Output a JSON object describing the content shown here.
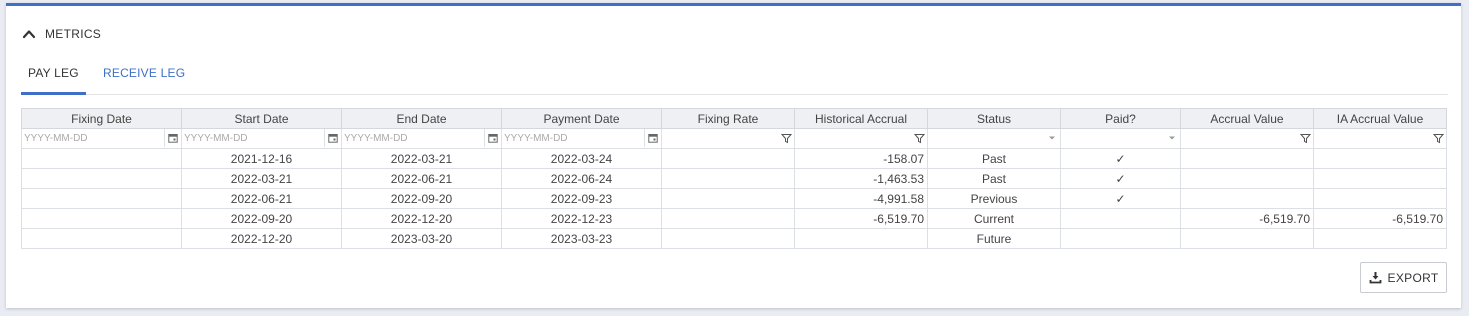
{
  "section": {
    "title": "METRICS",
    "icon": "chevron-up-icon"
  },
  "tabs": [
    {
      "label": "PAY LEG",
      "active": true
    },
    {
      "label": "RECEIVE LEG",
      "active": false
    }
  ],
  "table": {
    "columns": [
      "Fixing Date",
      "Start Date",
      "End Date",
      "Payment Date",
      "Fixing Rate",
      "Historical Accrual",
      "Status",
      "Paid?",
      "Accrual Value",
      "IA Accrual Value"
    ],
    "filters": {
      "date_placeholder": "YYYY-MM-DD",
      "fixing_date": "YYYY-MM-DD",
      "start_date": "YYYY-MM-DD",
      "end_date": "YYYY-MM-DD",
      "payment_date": "YYYY-MM-DD"
    },
    "rows": [
      {
        "fixing_date": "",
        "start_date": "2021-12-16",
        "end_date": "2022-03-21",
        "payment_date": "2022-03-24",
        "fixing_rate": "",
        "historical_accrual": "-158.07",
        "status": "Past",
        "paid": "✓",
        "accrual_value": "",
        "ia_accrual_value": ""
      },
      {
        "fixing_date": "",
        "start_date": "2022-03-21",
        "end_date": "2022-06-21",
        "payment_date": "2022-06-24",
        "fixing_rate": "",
        "historical_accrual": "-1,463.53",
        "status": "Past",
        "paid": "✓",
        "accrual_value": "",
        "ia_accrual_value": ""
      },
      {
        "fixing_date": "",
        "start_date": "2022-06-21",
        "end_date": "2022-09-20",
        "payment_date": "2022-09-23",
        "fixing_rate": "",
        "historical_accrual": "-4,991.58",
        "status": "Previous",
        "paid": "✓",
        "accrual_value": "",
        "ia_accrual_value": ""
      },
      {
        "fixing_date": "",
        "start_date": "2022-09-20",
        "end_date": "2022-12-20",
        "payment_date": "2022-12-23",
        "fixing_rate": "",
        "historical_accrual": "-6,519.70",
        "status": "Current",
        "paid": "",
        "accrual_value": "-6,519.70",
        "ia_accrual_value": "-6,519.70"
      },
      {
        "fixing_date": "",
        "start_date": "2022-12-20",
        "end_date": "2023-03-20",
        "payment_date": "2023-03-23",
        "fixing_rate": "",
        "historical_accrual": "",
        "status": "Future",
        "paid": "",
        "accrual_value": "",
        "ia_accrual_value": ""
      }
    ]
  },
  "export": {
    "label": "EXPORT",
    "icon": "download-icon"
  },
  "colors": {
    "accent": "#3f6fc7",
    "header_bg": "#eef0f3",
    "border": "#d4d7dc"
  }
}
